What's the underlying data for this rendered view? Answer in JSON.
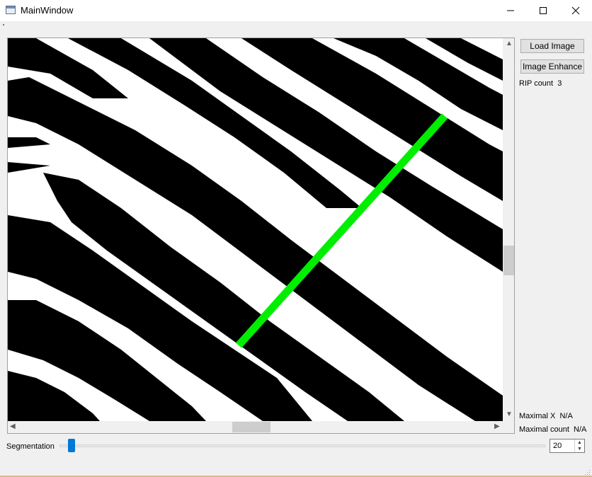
{
  "window": {
    "title": "MainWindow"
  },
  "controls": {
    "load_image": "Load Image",
    "image_enhance": "Image Enhance"
  },
  "stats": {
    "rip_label": "RIP count",
    "rip_value": "3",
    "maximal_x_label": "Maximal X",
    "maximal_x_value": "N/A",
    "maximal_count_label": "Maximal count",
    "maximal_count_value": "N/A"
  },
  "segmentation": {
    "label": "Segmentation",
    "value": "20"
  },
  "icons": {
    "minimize": "minimize-icon",
    "maximize": "maximize-icon",
    "close": "close-icon"
  },
  "colors": {
    "line": "#00ee00",
    "accent": "#0078d7"
  }
}
